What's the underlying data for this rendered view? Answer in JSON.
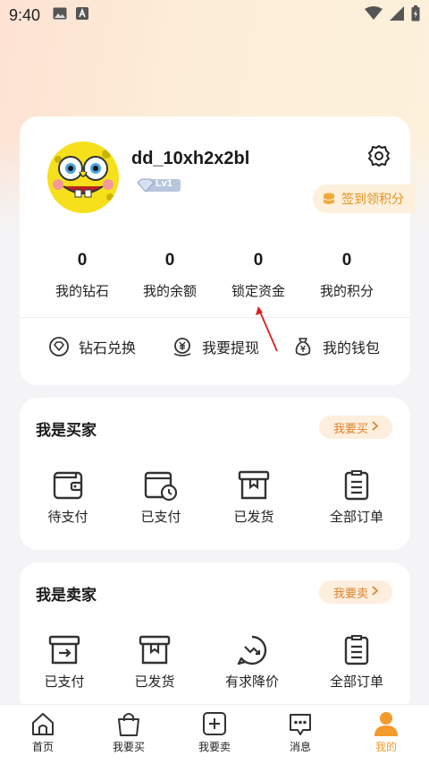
{
  "status_bar": {
    "time": "9:40"
  },
  "profile": {
    "username": "dd_10xh2x2bl",
    "level": "Lv1",
    "signin_label": "签到领积分"
  },
  "stats": [
    {
      "value": "0",
      "label": "我的钻石"
    },
    {
      "value": "0",
      "label": "我的余额"
    },
    {
      "value": "0",
      "label": "锁定资金"
    },
    {
      "value": "0",
      "label": "我的积分"
    }
  ],
  "actions": [
    {
      "label": "钻石兑换",
      "icon": "diamond-icon"
    },
    {
      "label": "我要提现",
      "icon": "withdraw-icon"
    },
    {
      "label": "我的钱包",
      "icon": "wallet-bag-icon"
    }
  ],
  "buyer": {
    "title": "我是买家",
    "button": "我要买",
    "items": [
      {
        "label": "待支付",
        "icon": "wallet-icon"
      },
      {
        "label": "已支付",
        "icon": "paid-clock-icon"
      },
      {
        "label": "已发货",
        "icon": "box-icon"
      },
      {
        "label": "全部订单",
        "icon": "clipboard-icon"
      }
    ]
  },
  "seller": {
    "title": "我是卖家",
    "button": "我要卖",
    "items": [
      {
        "label": "已支付",
        "icon": "box-export-icon"
      },
      {
        "label": "已发货",
        "icon": "box-icon"
      },
      {
        "label": "有求降价",
        "icon": "price-drop-icon"
      },
      {
        "label": "全部订单",
        "icon": "clipboard-icon"
      }
    ]
  },
  "nav": [
    {
      "label": "首页",
      "icon": "home-icon"
    },
    {
      "label": "我要买",
      "icon": "shopping-bag-icon"
    },
    {
      "label": "我要卖",
      "icon": "plus-square-icon"
    },
    {
      "label": "消息",
      "icon": "message-icon"
    },
    {
      "label": "我的",
      "icon": "user-icon"
    }
  ],
  "colors": {
    "accent": "#f39a2c",
    "pill_bg": "#fdeedd",
    "signin_text": "#e7931f"
  }
}
